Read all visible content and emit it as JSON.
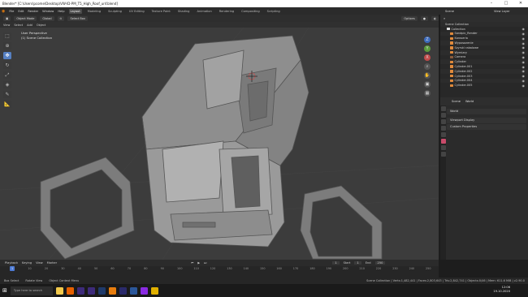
{
  "window": {
    "title": "Blender* [C:\\Users\\pcome\\Desktop\\VW-ID-PM_T5_High_Roof_unf.blend]",
    "controls": [
      "–",
      "□",
      "✕"
    ]
  },
  "menubar": {
    "items": [
      "File",
      "Edit",
      "Render",
      "Window",
      "Help"
    ],
    "workspaces": [
      "Layout",
      "Modeling",
      "Sculpting",
      "UV Editing",
      "Texture Paint",
      "Shading",
      "Animation",
      "Rendering",
      "Compositing",
      "Scripting"
    ],
    "active_workspace": "Layout",
    "scene_label": "Scene",
    "view_layer_label": "View Layer"
  },
  "viewport_header": {
    "mode": "Object Mode",
    "menus": [
      "View",
      "Select",
      "Add",
      "Object"
    ],
    "orientation": "Global",
    "drag": "Select Box",
    "options": "Options"
  },
  "viewport": {
    "info_line1": "User Perspective",
    "info_line2": "(1) Scene Collection",
    "gizmo_axes": [
      "Z",
      "Y",
      "X"
    ]
  },
  "tools": [
    "select",
    "cursor",
    "move",
    "rotate",
    "scale",
    "transform",
    "annotate",
    "measure"
  ],
  "timeline": {
    "menus": [
      "Playback",
      "Keying",
      "View",
      "Marker"
    ],
    "current_frame": "1",
    "start_label": "Start",
    "start": "1",
    "end_label": "End",
    "end": "250",
    "ticks": [
      "0",
      "10",
      "20",
      "30",
      "40",
      "50",
      "60",
      "70",
      "80",
      "90",
      "100",
      "110",
      "120",
      "130",
      "140",
      "150",
      "160",
      "170",
      "180",
      "190",
      "200",
      "210",
      "220",
      "230",
      "240",
      "250"
    ]
  },
  "statusbar": {
    "select": "Box Select",
    "rotate": "Rotate View",
    "context": "Object Context Menu",
    "stats": "Scene Collection | Verts:1,482,441 | Faces:2,803,643 | Tris:2,842,741 | Objects:0/46 | Mem: 611.6 MiB | v2.90.0"
  },
  "outliner": {
    "title": "Scene Collection",
    "rows": [
      {
        "name": "Collection",
        "type": "col"
      },
      {
        "name": "Sandpic_Render",
        "type": "obj"
      },
      {
        "name": "Karoseria",
        "type": "obj"
      },
      {
        "name": "Wyposazenie",
        "type": "obj"
      },
      {
        "name": "Szyrski rabalowe",
        "type": "obj"
      },
      {
        "name": "Wymiary",
        "type": "obj"
      },
      {
        "name": "Camera",
        "type": "cam"
      },
      {
        "name": "Cylinder",
        "type": "obj"
      },
      {
        "name": "Cylinder.001",
        "type": "obj"
      },
      {
        "name": "Cylinder.002",
        "type": "obj"
      },
      {
        "name": "Cylinder.003",
        "type": "obj"
      },
      {
        "name": "Cylinder.004",
        "type": "obj"
      },
      {
        "name": "Cylinder.005",
        "type": "obj"
      }
    ]
  },
  "properties": {
    "tabs": [
      "Scene",
      "World"
    ],
    "world_name": "World",
    "panels": [
      "Viewport Display",
      "Custom Properties"
    ]
  },
  "taskbar": {
    "search_placeholder": "Type here to search",
    "time": "12:06",
    "date": "19.10.2020",
    "apps": [
      {
        "name": "explorer",
        "color": "#f2c94c"
      },
      {
        "name": "firefox",
        "color": "#e66000"
      },
      {
        "name": "premiere",
        "color": "#3d2a7a"
      },
      {
        "name": "after-effects",
        "color": "#3d2a7a"
      },
      {
        "name": "photoshop",
        "color": "#1f3a6b"
      },
      {
        "name": "blender",
        "color": "#e87d0d"
      },
      {
        "name": "media-encoder",
        "color": "#2a2a6b"
      },
      {
        "name": "word",
        "color": "#2b579a"
      },
      {
        "name": "app-3",
        "color": "#8a2be2"
      },
      {
        "name": "app-4",
        "color": "#e0b000"
      }
    ]
  },
  "colors": {
    "accent": "#5680c2",
    "active_tab": "#c94b6a",
    "object_icon": "#e08a3c"
  }
}
